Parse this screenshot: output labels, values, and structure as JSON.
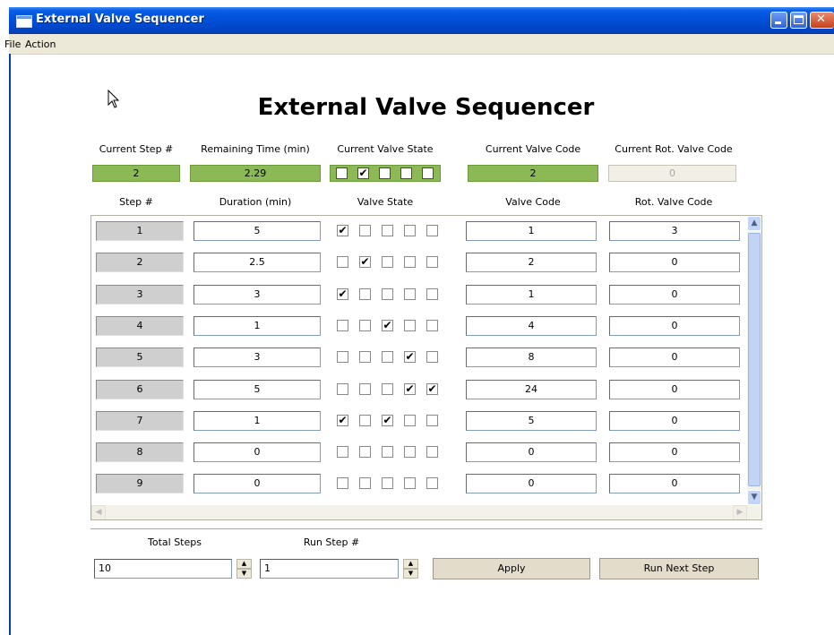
{
  "window": {
    "title": "External Valve Sequencer"
  },
  "menu": [
    "File",
    "Action"
  ],
  "heading": "External Valve Sequencer",
  "status": {
    "current_step_label": "Current Step #",
    "current_step": "2",
    "remaining_time_label": "Remaining Time (min)",
    "remaining_time": "2.29",
    "current_valve_state_label": "Current Valve State",
    "current_valve_state": [
      false,
      true,
      false,
      false,
      false
    ],
    "current_valve_code_label": "Current Valve Code",
    "current_valve_code": "2",
    "current_rot_valve_code_label": "Current Rot. Valve Code",
    "current_rot_valve_code": "0"
  },
  "table": {
    "headers": [
      "Step #",
      "Duration (min)",
      "Valve State",
      "Valve Code",
      "Rot. Valve Code"
    ],
    "rows": [
      {
        "step": "1",
        "duration": "5",
        "valves": [
          true,
          false,
          false,
          false,
          false
        ],
        "valve_code": "1",
        "rot_code": "3"
      },
      {
        "step": "2",
        "duration": "2.5",
        "valves": [
          false,
          true,
          false,
          false,
          false
        ],
        "valve_code": "2",
        "rot_code": "0"
      },
      {
        "step": "3",
        "duration": "3",
        "valves": [
          true,
          false,
          false,
          false,
          false
        ],
        "valve_code": "1",
        "rot_code": "0"
      },
      {
        "step": "4",
        "duration": "1",
        "valves": [
          false,
          false,
          true,
          false,
          false
        ],
        "valve_code": "4",
        "rot_code": "0"
      },
      {
        "step": "5",
        "duration": "3",
        "valves": [
          false,
          false,
          false,
          true,
          false
        ],
        "valve_code": "8",
        "rot_code": "0"
      },
      {
        "step": "6",
        "duration": "5",
        "valves": [
          false,
          false,
          false,
          true,
          true
        ],
        "valve_code": "24",
        "rot_code": "0"
      },
      {
        "step": "7",
        "duration": "1",
        "valves": [
          true,
          false,
          true,
          false,
          false
        ],
        "valve_code": "5",
        "rot_code": "0"
      },
      {
        "step": "8",
        "duration": "0",
        "valves": [
          false,
          false,
          false,
          false,
          false
        ],
        "valve_code": "0",
        "rot_code": "0"
      },
      {
        "step": "9",
        "duration": "0",
        "valves": [
          false,
          false,
          false,
          false,
          false
        ],
        "valve_code": "0",
        "rot_code": "0"
      }
    ]
  },
  "controls": {
    "total_steps_label": "Total Steps",
    "total_steps": "10",
    "run_step_label": "Run Step #",
    "run_step": "1",
    "apply_label": "Apply",
    "run_next_label": "Run Next Step"
  }
}
